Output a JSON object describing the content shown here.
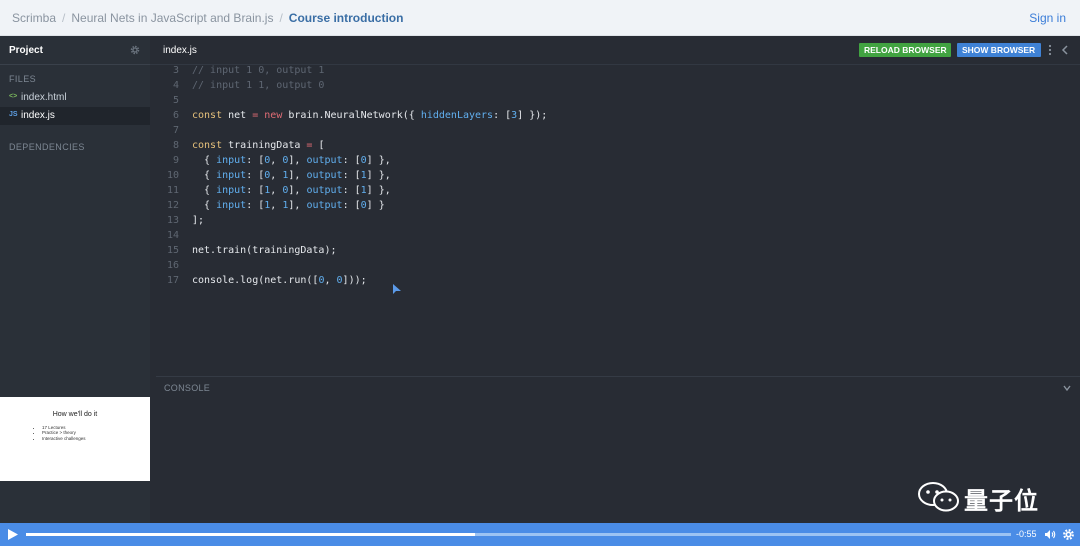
{
  "breadcrumb": {
    "items": [
      "Scrimba",
      "Neural Nets in JavaScript and Brain.js",
      "Course introduction"
    ],
    "sep": "/"
  },
  "header": {
    "signin_label": "Sign in"
  },
  "sidebar": {
    "project_title": "Project",
    "files_label": "FILES",
    "files": [
      {
        "icon": "<>",
        "name": "index.html"
      },
      {
        "icon": "JS",
        "name": "index.js"
      }
    ],
    "dependencies_label": "DEPENDENCIES",
    "slide": {
      "title": "How we'll do it",
      "bullets": [
        "17 Lectures",
        "Practice > theory",
        "Interactive challenges"
      ]
    }
  },
  "editor": {
    "tab_name": "index.js",
    "reload_label": "RELOAD BROWSER",
    "show_label": "SHOW BROWSER",
    "lines": [
      {
        "n": "3",
        "text": "// input 1 0, output 1"
      },
      {
        "n": "4",
        "text": "// input 1 1, output 0"
      },
      {
        "n": "5",
        "text": ""
      },
      {
        "n": "6",
        "text": "const net = new brain.NeuralNetwork({ hiddenLayers: [3] });"
      },
      {
        "n": "7",
        "text": ""
      },
      {
        "n": "8",
        "text": "const trainingData = ["
      },
      {
        "n": "9",
        "text": "  { input: [0, 0], output: [0] },"
      },
      {
        "n": "10",
        "text": "  { input: [0, 1], output: [1] },"
      },
      {
        "n": "11",
        "text": "  { input: [1, 0], output: [1] },"
      },
      {
        "n": "12",
        "text": "  { input: [1, 1], output: [0] }"
      },
      {
        "n": "13",
        "text": "];"
      },
      {
        "n": "14",
        "text": ""
      },
      {
        "n": "15",
        "text": "net.train(trainingData);"
      },
      {
        "n": "16",
        "text": ""
      },
      {
        "n": "17",
        "text": "console.log(net.run([0, 0]));"
      }
    ]
  },
  "console": {
    "label": "CONSOLE"
  },
  "watermark": {
    "text": "量子位"
  },
  "player": {
    "time": "-0:55",
    "progress_fraction": 0.456
  },
  "colors": {
    "accent": "#4a8ce6",
    "reload": "#41a341",
    "show": "#3f82d6",
    "sidebar": "#2a3038",
    "editor": "#282c34"
  }
}
